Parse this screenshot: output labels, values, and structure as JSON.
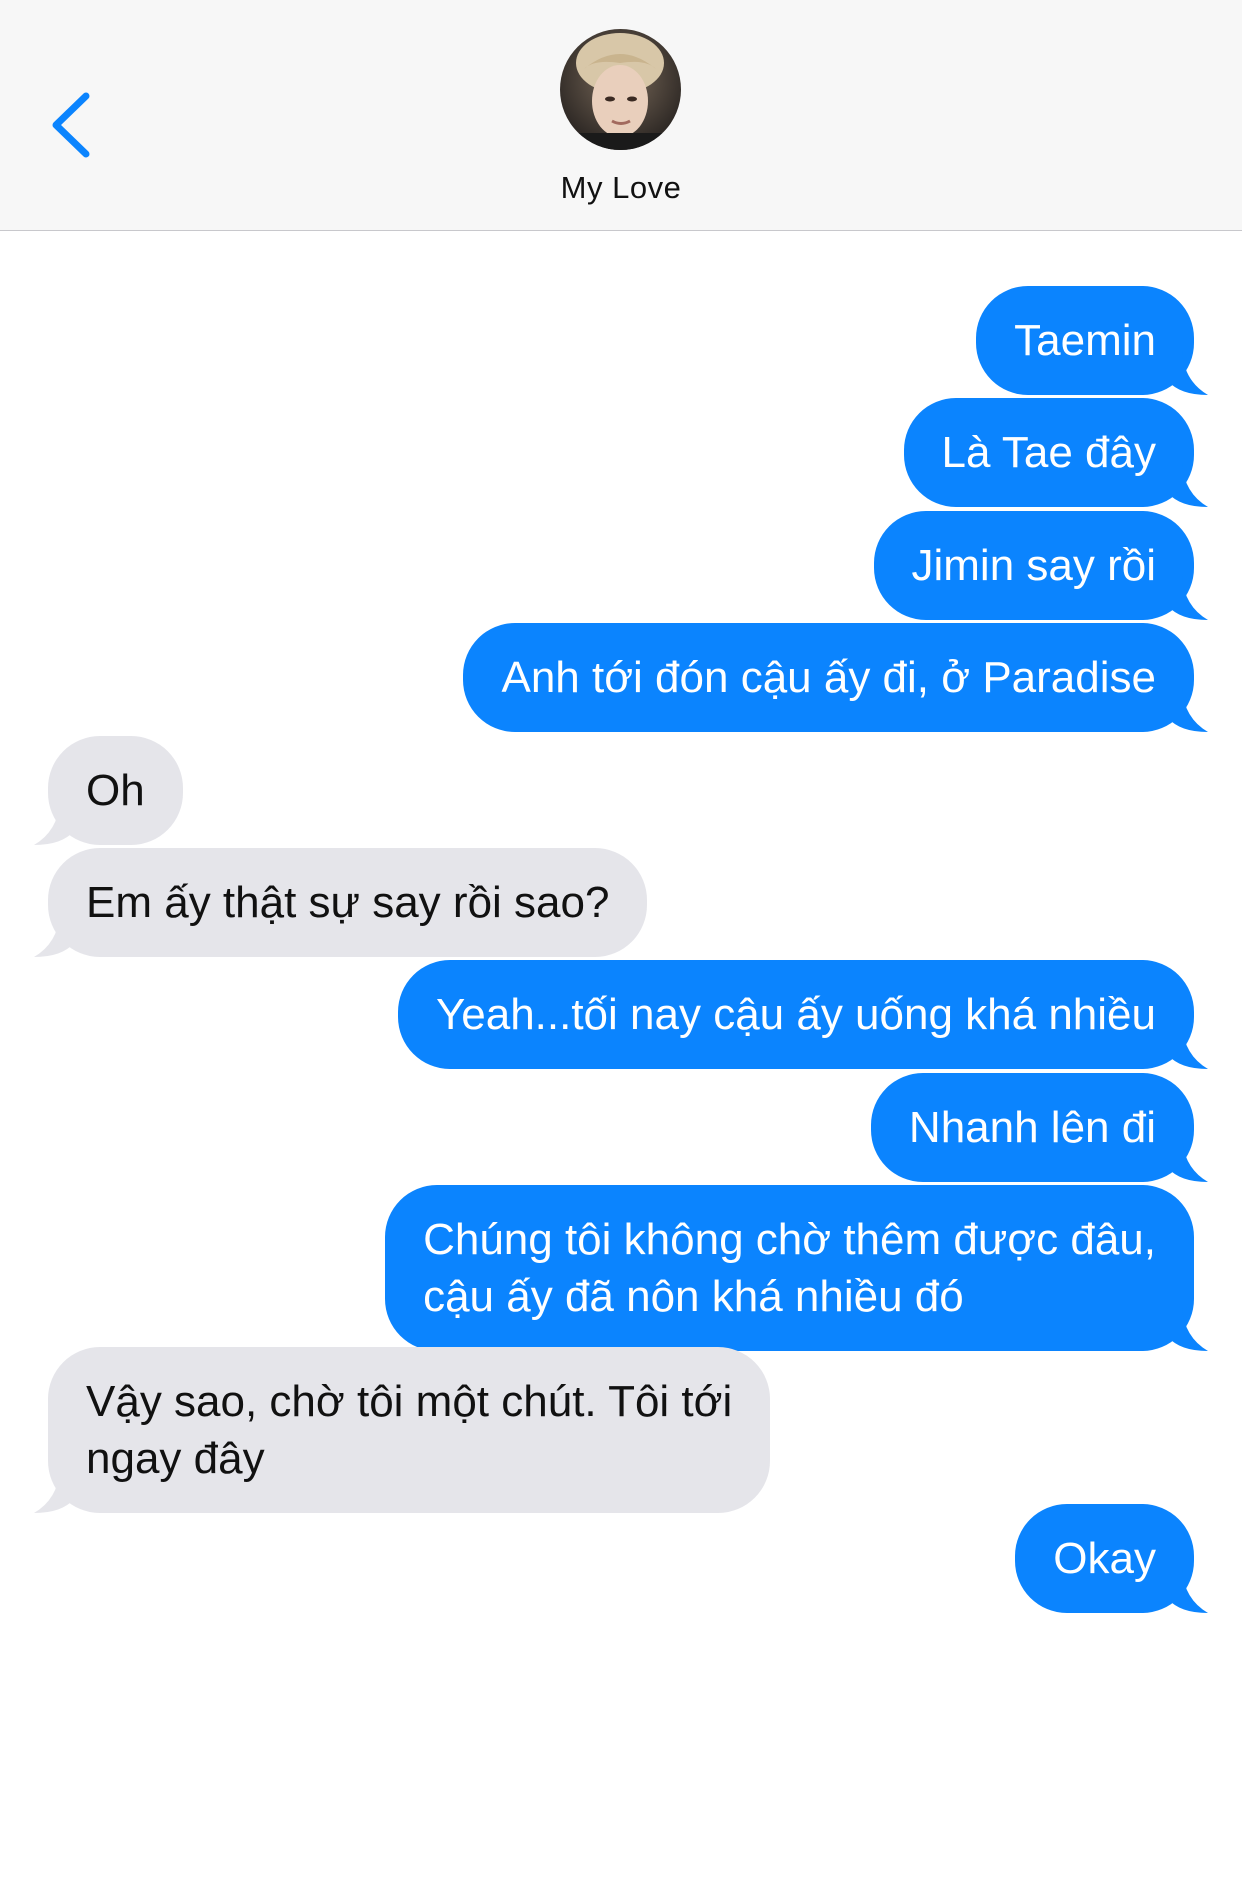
{
  "header": {
    "contact_name": "My Love",
    "back_icon": "chevron-left-icon",
    "avatar_icon": "contact-avatar"
  },
  "colors": {
    "sent_bubble": "#0b84fe",
    "received_bubble": "#e5e5ea",
    "header_bg": "#f7f7f7",
    "accent": "#0b84fe"
  },
  "messages": [
    {
      "direction": "sent",
      "text": "Taemin"
    },
    {
      "direction": "sent",
      "text": "Là Tae đây"
    },
    {
      "direction": "sent",
      "text": "Jimin say rồi"
    },
    {
      "direction": "sent",
      "text": "Anh tới đón cậu ấy đi, ở Paradise"
    },
    {
      "direction": "received",
      "text": "Oh"
    },
    {
      "direction": "received",
      "text": "Em ấy thật sự say rồi sao?"
    },
    {
      "direction": "sent",
      "text": "Yeah...tối nay cậu ấy uống khá nhiều"
    },
    {
      "direction": "sent",
      "text": "Nhanh lên đi"
    },
    {
      "direction": "sent",
      "text": "Chúng tôi không chờ thêm được đâu,\ncậu ấy đã nôn khá nhiều đó"
    },
    {
      "direction": "received",
      "text": "Vậy sao, chờ tôi một chút. Tôi tới\nngay đây"
    },
    {
      "direction": "sent",
      "text": "Okay"
    }
  ]
}
